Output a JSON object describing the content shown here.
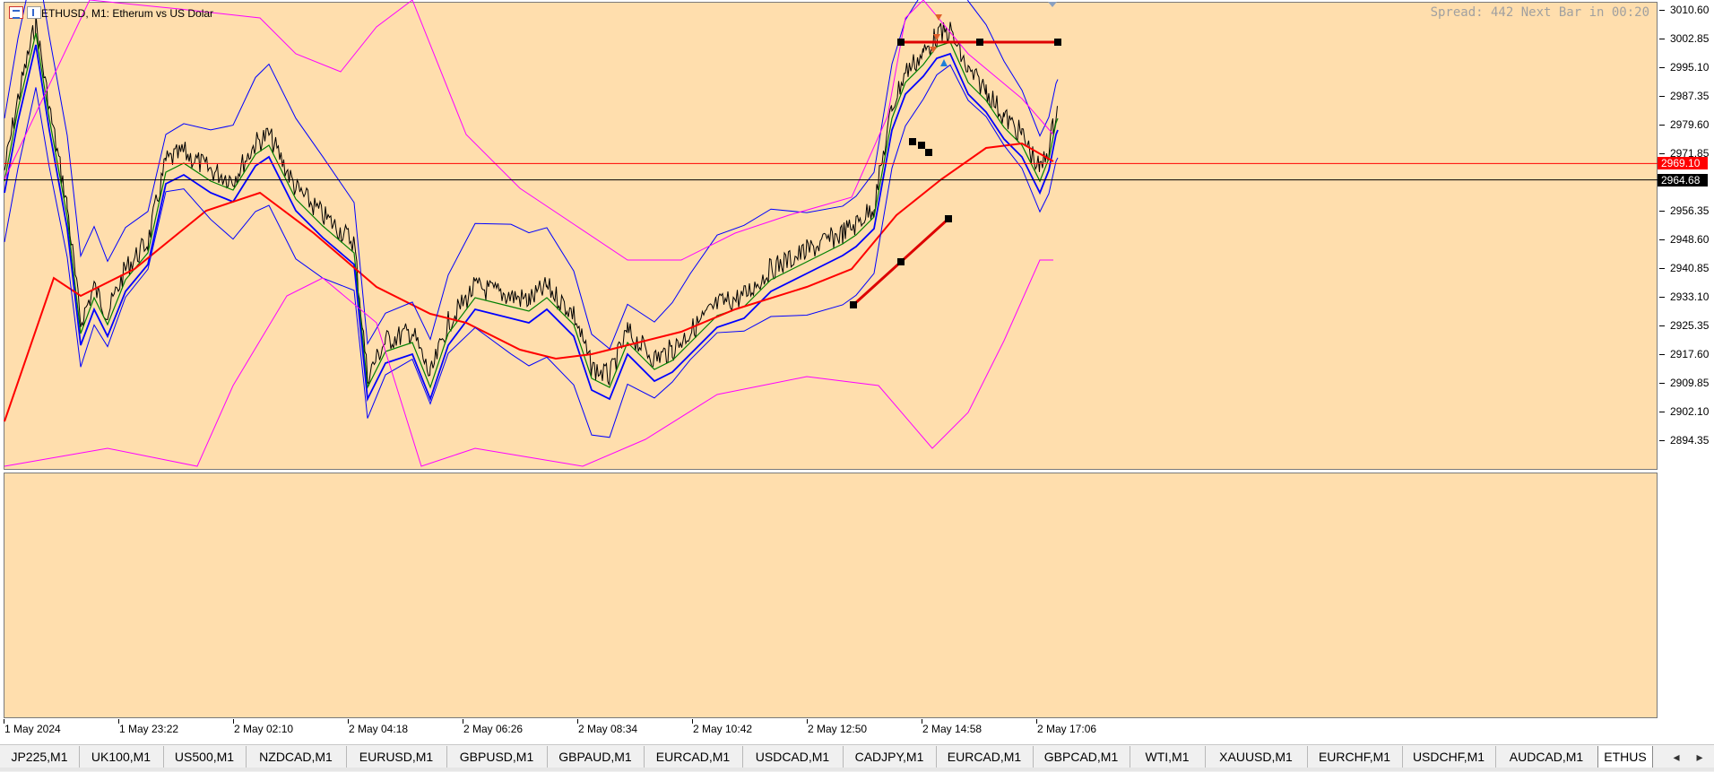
{
  "chart": {
    "symbol_title": "ETHUSD, M1:  Etherum vs US Dolar",
    "spread_text": "Spread: 442 Next Bar in 00:20",
    "price_levels": [
      "3010.60",
      "3002.85",
      "2995.10",
      "2987.35",
      "2979.60",
      "2971.85",
      "2956.35",
      "2948.60",
      "2940.85",
      "2933.10",
      "2925.35",
      "2917.60",
      "2909.85",
      "2902.10",
      "2894.35"
    ],
    "bid_price": "2969.10",
    "last_price": "2964.68",
    "time_labels": [
      "1 May 2024",
      "1 May 23:22",
      "2 May 02:10",
      "2 May 04:18",
      "2 May 06:26",
      "2 May 08:34",
      "2 May 10:42",
      "2 May 12:50",
      "2 May 14:58",
      "2 May 17:06"
    ],
    "colors": {
      "background": "#ffdead",
      "bid_line": "#ff0000",
      "price_line": "#000000",
      "ma_fast": "#008000",
      "ma_mid": "#0000ff",
      "ma_slow": "#ff0000",
      "envelope": "#ff00ff",
      "bands": "#0000ff"
    }
  },
  "tabs": [
    {
      "label": "JP225,M1"
    },
    {
      "label": "UK100,M1"
    },
    {
      "label": "US500,M1"
    },
    {
      "label": "NZDCAD,M1"
    },
    {
      "label": "EURUSD,M1"
    },
    {
      "label": "GBPUSD,M1"
    },
    {
      "label": "GBPAUD,M1"
    },
    {
      "label": "EURCAD,M1"
    },
    {
      "label": "USDCAD,M1"
    },
    {
      "label": "CADJPY,M1"
    },
    {
      "label": "EURCAD,M1"
    },
    {
      "label": "GBPCAD,M1"
    },
    {
      "label": "WTI,M1"
    },
    {
      "label": "XAUUSD,M1"
    },
    {
      "label": "EURCHF,M1"
    },
    {
      "label": "USDCHF,M1"
    },
    {
      "label": "AUDCAD,M1"
    },
    {
      "label": "ETHUS"
    }
  ],
  "tab_nav": {
    "prev": "◂",
    "next": "▸"
  }
}
